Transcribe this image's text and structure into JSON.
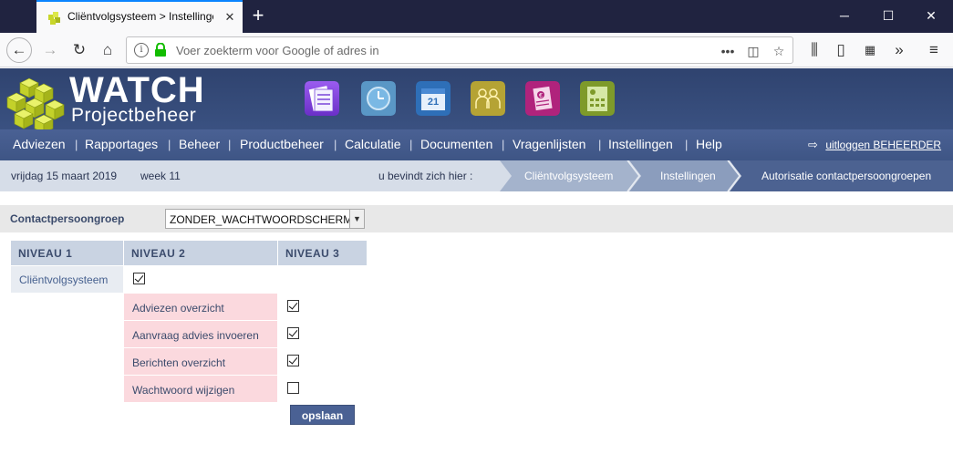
{
  "browser": {
    "tab_title": "Cliëntvolgsysteem > Instellingen",
    "address_placeholder": "Voer zoekterm voor Google of adres in",
    "more_label": "•••"
  },
  "app": {
    "brand": "WATCH",
    "brand_sub": "Projectbeheer",
    "icons": [
      "documents-app-icon",
      "clock-app-icon",
      "calendar-app-icon",
      "users-app-icon",
      "invoice-app-icon",
      "calculator-app-icon"
    ],
    "calendar_day": "21"
  },
  "menu": {
    "items": [
      "Adviezen",
      "Rapportages",
      "Beheer",
      "Productbeheer",
      "Calculatie",
      "Documenten",
      "Vragenlijsten",
      "Instellingen",
      "Help"
    ],
    "separator": "|",
    "logout": "uitloggen BEHEERDER"
  },
  "breadbar": {
    "date": "vrijdag 15 maart 2019",
    "week": "week 11",
    "here_label": "u bevindt zich hier :",
    "crumbs": [
      "Cliëntvolgsysteem",
      "Instellingen",
      "Autorisatie contactpersoongroepen"
    ]
  },
  "filter": {
    "label": "Contactpersoongroep",
    "selected": "ZONDER_WACHTWOORDSCHERM"
  },
  "table": {
    "headers": [
      "NIVEAU 1",
      "NIVEAU 2",
      "NIVEAU 3"
    ],
    "level1": {
      "label": "Cliëntvolgsysteem",
      "checked": true
    },
    "level2": [
      {
        "label": "Adviezen overzicht",
        "checked": true
      },
      {
        "label": "Aanvraag advies invoeren",
        "checked": true
      },
      {
        "label": "Berichten overzicht",
        "checked": true
      },
      {
        "label": "Wachtwoord wijzigen",
        "checked": false
      }
    ]
  },
  "save_label": "opslaan",
  "colors": {
    "header_bg": "#34497a",
    "menu_bg": "#4a6194",
    "table_header": "#c9d3e2",
    "row_pink": "#fbd9de",
    "crumb_bg": "#a4b3cc"
  }
}
